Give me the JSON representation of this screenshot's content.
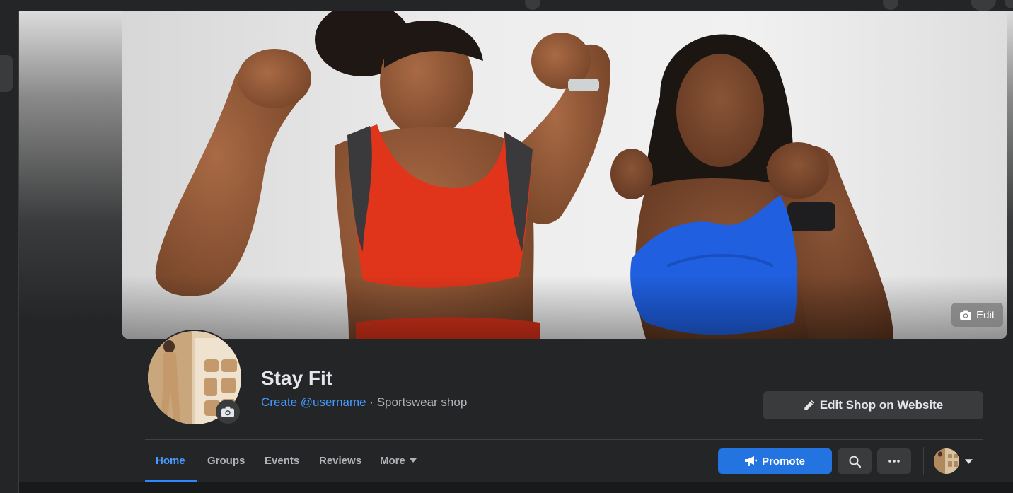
{
  "page": {
    "name": "Stay Fit",
    "username_link": "Create @username",
    "separator": " · ",
    "category": "Sportswear shop"
  },
  "cover": {
    "edit_label": "Edit"
  },
  "actions": {
    "edit_shop_label": "Edit Shop on Website",
    "promote_label": "Promote"
  },
  "tabs": [
    {
      "label": "Home",
      "active": true
    },
    {
      "label": "Groups"
    },
    {
      "label": "Events"
    },
    {
      "label": "Reviews"
    },
    {
      "label": "More"
    }
  ],
  "icons": {
    "cover_edit": "camera-icon",
    "profile_edit": "camera-icon",
    "edit_shop": "pencil-icon",
    "promote": "megaphone-icon",
    "search": "search-icon",
    "more_options": "ellipsis-icon",
    "more_tab": "caret-down-icon",
    "account_switch": "caret-down-icon"
  },
  "colors": {
    "accent": "#2374e1",
    "link": "#4599ff",
    "background": "#18191a",
    "surface": "#242526",
    "button": "#3a3b3c"
  }
}
